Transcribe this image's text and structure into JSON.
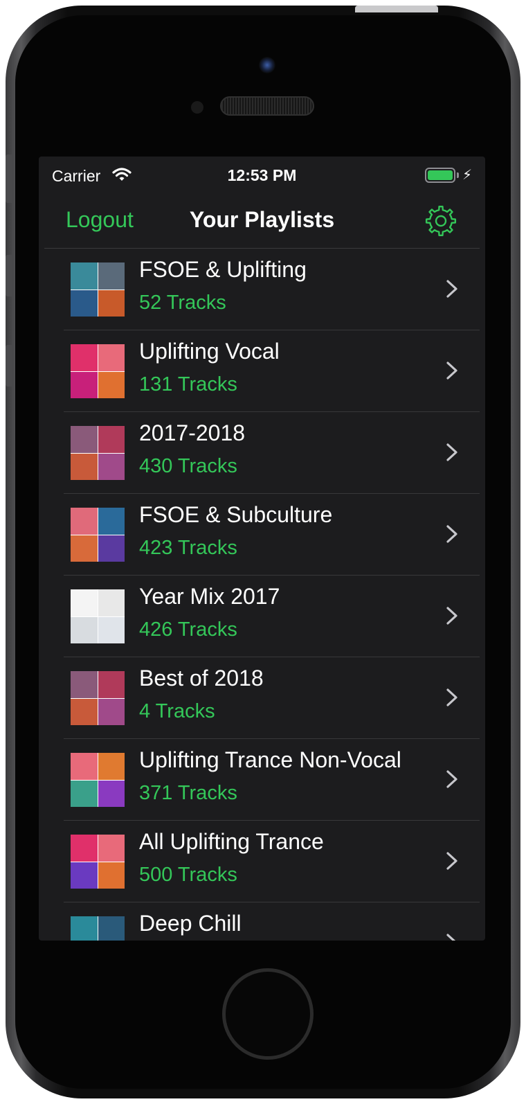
{
  "status_bar": {
    "carrier": "Carrier",
    "time": "12:53 PM"
  },
  "nav": {
    "left_button": "Logout",
    "title": "Your Playlists",
    "right_icon": "gear-icon"
  },
  "colors": {
    "accent": "#34c759",
    "background": "#1c1c1e",
    "text": "#ffffff"
  },
  "playlists": [
    {
      "name": "FSOE & Uplifting",
      "tracks": "52 Tracks"
    },
    {
      "name": "Uplifting Vocal",
      "tracks": "131 Tracks"
    },
    {
      "name": "2017-2018",
      "tracks": "430 Tracks"
    },
    {
      "name": "FSOE & Subculture",
      "tracks": "423 Tracks"
    },
    {
      "name": "Year Mix 2017",
      "tracks": "426 Tracks"
    },
    {
      "name": "Best of 2018",
      "tracks": "4 Tracks"
    },
    {
      "name": "Uplifting Trance Non-Vocal",
      "tracks": "371 Tracks"
    },
    {
      "name": "All Uplifting Trance",
      "tracks": "500 Tracks"
    },
    {
      "name": "Deep Chill",
      "tracks": ""
    }
  ]
}
